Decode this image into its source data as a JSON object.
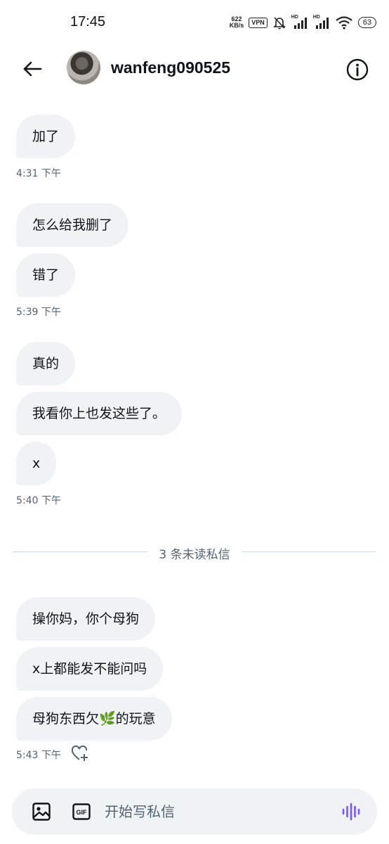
{
  "status_bar": {
    "time": "17:45",
    "net_speed_value": "622",
    "net_speed_unit": "KB/s",
    "vpn": "VPN",
    "signal_hd": "HD",
    "battery": "63",
    "icons": [
      "mute-bell-icon",
      "signal-icon",
      "signal-icon",
      "wifi-icon",
      "battery-icon"
    ]
  },
  "header": {
    "username": "wanfeng090525",
    "icons": [
      "back-arrow-icon",
      "avatar",
      "info-icon"
    ]
  },
  "messages": {
    "group1": {
      "bubbles": [
        "加了"
      ],
      "time": "4:31 下午"
    },
    "group2": {
      "bubbles": [
        "怎么给我删了",
        "错了"
      ],
      "time": "5:39 下午"
    },
    "group3": {
      "bubbles": [
        "真的",
        "我看你上也发这些了。",
        "x"
      ],
      "time": "5:40 下午"
    },
    "unread_divider": "3 条未读私信",
    "group4": {
      "bubbles": [
        "操你妈，你个母狗",
        "x上都能发不能问吗",
        "母狗东西欠🌿的玩意"
      ],
      "time": "5:43 下午"
    }
  },
  "composer": {
    "placeholder": "开始写私信",
    "gif_label": "GIF",
    "icons": [
      "image-icon",
      "gif-icon",
      "voice-wave-icon"
    ]
  },
  "colors": {
    "bubble_bg": "#eff3f4",
    "text": "#0f1419",
    "secondary_text": "#536471",
    "divider": "#cfd9de",
    "accent_voice": "#7856ff"
  }
}
